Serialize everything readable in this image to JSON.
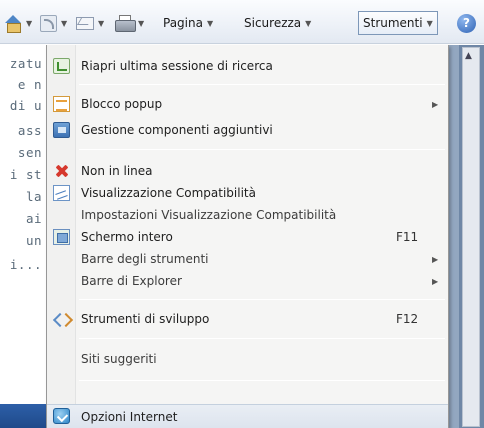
{
  "command_bar": {
    "pagina": "Pagina",
    "sicurezza": "Sicurezza",
    "strumenti": "Strumenti",
    "home_icon": "home-icon",
    "feeds_icon": "rss-feed-icon",
    "mail_icon": "mail-icon",
    "print_icon": "print-icon",
    "help_icon": "help-icon"
  },
  "page_fragments": [
    "zatu",
    "e n",
    "di u",
    "ass",
    "sen",
    "i st",
    "la",
    "ai",
    "un",
    "i..."
  ],
  "menu": {
    "items": [
      {
        "label": "Riapri ultima sessione di ricerca",
        "icon": "reopen-session-icon"
      },
      {
        "label": "Blocco popup",
        "icon": "popup-blocker-icon",
        "submenu": true
      },
      {
        "label": "Gestione componenti aggiuntivi",
        "icon": "manage-addons-icon"
      },
      {
        "label": "Non in linea",
        "icon": "work-offline-icon"
      },
      {
        "label": "Visualizzazione Compatibilità",
        "icon": "compatibility-view-icon"
      },
      {
        "label": "Impostazioni Visualizzazione Compatibilità"
      },
      {
        "label": "Schermo intero",
        "icon": "full-screen-icon",
        "shortcut": "F11"
      },
      {
        "label": "Barre degli strumenti",
        "submenu": true
      },
      {
        "label": "Barre di Explorer",
        "submenu": true
      },
      {
        "label": "Strumenti di sviluppo",
        "icon": "developer-tools-icon",
        "shortcut": "F12"
      },
      {
        "label": "Siti suggeriti"
      },
      {
        "label": "Opzioni Internet",
        "icon": "internet-options-icon",
        "highlighted": true
      }
    ]
  },
  "colors": {
    "menu_background": "#f5f5f4",
    "highlight": "#dde4ee",
    "page_text": "#5a6b7a"
  }
}
